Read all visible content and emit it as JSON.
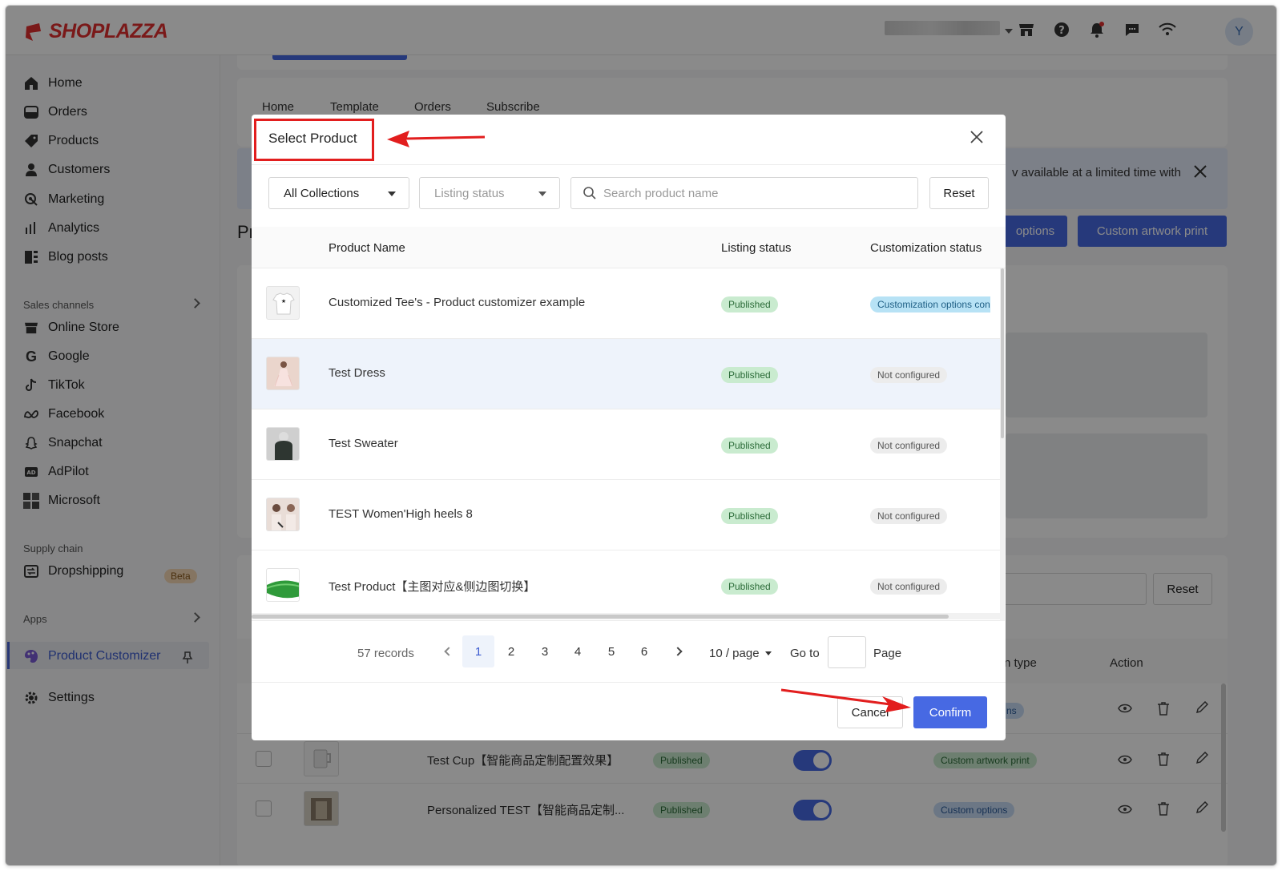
{
  "brand": {
    "logo_text": "SHOPLAZZA",
    "accent": "#4769e3",
    "brand_red": "#e12f2f"
  },
  "topbar": {
    "avatar_initial": "Y",
    "icons": [
      "store-icon",
      "help-icon",
      "bell-icon",
      "chat-icon",
      "wifi-icon"
    ]
  },
  "sidebar": {
    "items": [
      {
        "label": "Home",
        "icon": "home-icon"
      },
      {
        "label": "Orders",
        "icon": "orders-icon"
      },
      {
        "label": "Products",
        "icon": "tag-icon"
      },
      {
        "label": "Customers",
        "icon": "person-icon"
      },
      {
        "label": "Marketing",
        "icon": "marketing-icon"
      },
      {
        "label": "Analytics",
        "icon": "analytics-icon"
      },
      {
        "label": "Blog posts",
        "icon": "blog-icon"
      }
    ],
    "sales_channels_label": "Sales channels",
    "channels": [
      {
        "label": "Online Store",
        "icon": "store-icon"
      },
      {
        "label": "Google",
        "icon": "google-icon"
      },
      {
        "label": "TikTok",
        "icon": "tiktok-icon"
      },
      {
        "label": "Facebook",
        "icon": "meta-icon"
      },
      {
        "label": "Snapchat",
        "icon": "snapchat-icon"
      },
      {
        "label": "AdPilot",
        "icon": "ad-icon"
      },
      {
        "label": "Microsoft",
        "icon": "microsoft-icon"
      }
    ],
    "supply_chain_label": "Supply chain",
    "dropshipping_label": "Dropshipping",
    "beta_label": "Beta",
    "apps_label": "Apps",
    "product_customizer_label": "Product Customizer",
    "settings_label": "Settings"
  },
  "background": {
    "tabs": [
      "Home",
      "Template",
      "Orders",
      "Subscribe"
    ],
    "page_title_fragment": "Pr",
    "banner_text": "v available at a limited time with",
    "btn_options": "options",
    "btn_custom_artwork": "Custom artwork print",
    "reset_label": "Reset",
    "col_type": "n type",
    "col_action": "Action",
    "chip_fragment": "ns",
    "rows": [
      {
        "name": "Test Cup【智能商品定制配置效果】",
        "status": "Published",
        "type": "Custom artwork print"
      },
      {
        "name": "Personalized TEST【智能商品定制...",
        "status": "Published",
        "type": "Custom options"
      }
    ]
  },
  "modal": {
    "title": "Select Product",
    "filters": {
      "collections": "All Collections",
      "listing_status_placeholder": "Listing status",
      "search_placeholder": "Search product name",
      "reset": "Reset"
    },
    "columns": {
      "name": "Product Name",
      "listing": "Listing status",
      "customization": "Customization status"
    },
    "rows": [
      {
        "name": "Customized Tee's - Product customizer example",
        "listing": "Published",
        "customization": "Customization options con",
        "thumb": "tshirt"
      },
      {
        "name": "Test Dress",
        "listing": "Published",
        "customization": "Not configured",
        "thumb": "dress"
      },
      {
        "name": "Test Sweater",
        "listing": "Published",
        "customization": "Not configured",
        "thumb": "sweater"
      },
      {
        "name": "TEST Women'High heels 8",
        "listing": "Published",
        "customization": "Not configured",
        "thumb": "heels"
      },
      {
        "name": "Test Product【主图对应&侧边图切换】",
        "listing": "Published",
        "customization": "Not configured",
        "thumb": "green"
      }
    ],
    "pagination": {
      "records": "57 records",
      "pages": [
        "1",
        "2",
        "3",
        "4",
        "5",
        "6"
      ],
      "current": "1",
      "page_size": "10 / page",
      "goto_label": "Go to",
      "page_label": "Page"
    },
    "footer": {
      "cancel": "Cancel",
      "confirm": "Confirm"
    }
  }
}
